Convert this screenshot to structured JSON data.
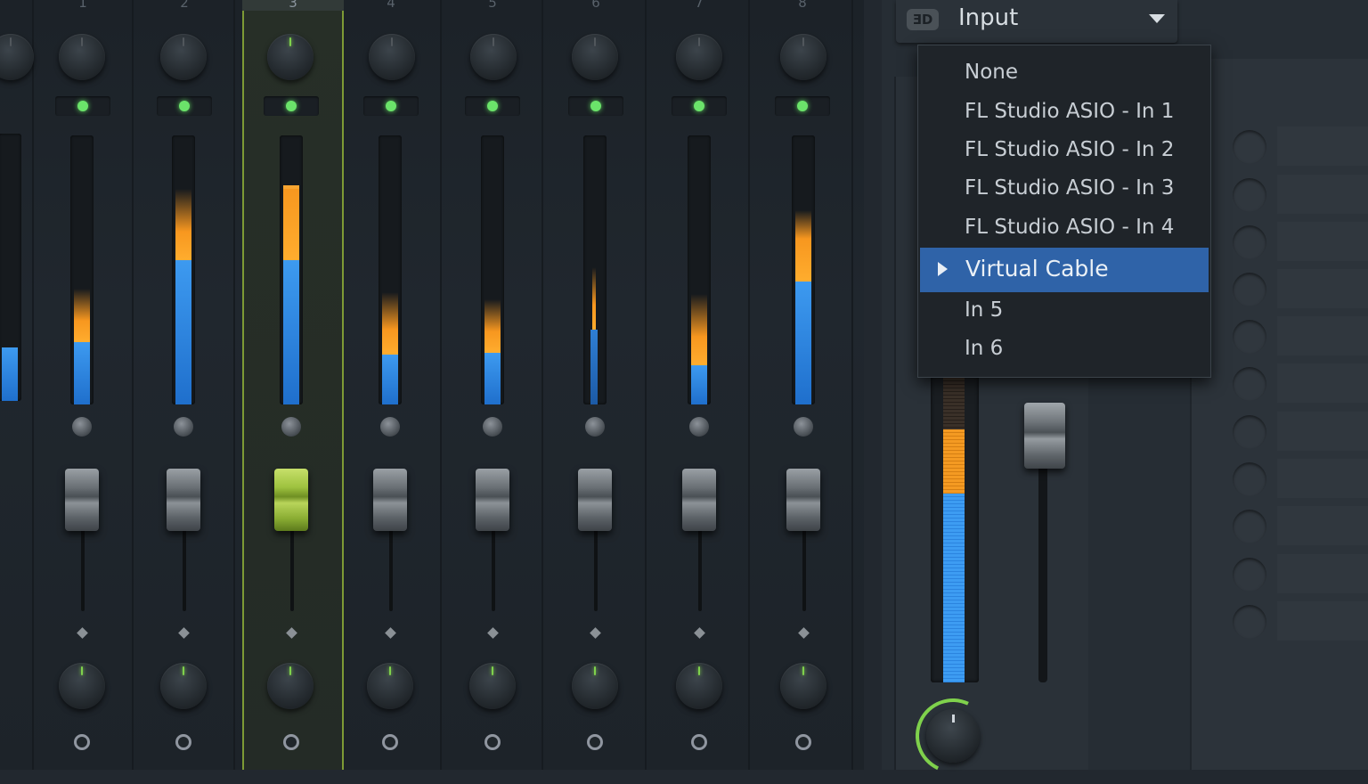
{
  "mixer": {
    "channels": [
      {
        "number": "1",
        "selected": false
      },
      {
        "number": "2",
        "selected": false
      },
      {
        "number": "3",
        "selected": true
      },
      {
        "number": "4",
        "selected": false
      },
      {
        "number": "5",
        "selected": false
      },
      {
        "number": "6",
        "selected": false
      },
      {
        "number": "7",
        "selected": false
      },
      {
        "number": "8",
        "selected": false
      }
    ]
  },
  "input_panel": {
    "label": "Input",
    "icon": "audio-input-icon"
  },
  "dropdown": {
    "items": [
      {
        "label": "None",
        "selected": false
      },
      {
        "label": "FL Studio ASIO - In 1",
        "selected": false
      },
      {
        "label": "FL Studio ASIO - In 2",
        "selected": false
      },
      {
        "label": "FL Studio ASIO - In 3",
        "selected": false
      },
      {
        "label": "FL Studio ASIO - In 4",
        "selected": false
      },
      {
        "label": "Virtual Cable",
        "selected": true
      },
      {
        "label": "In 5",
        "selected": false
      },
      {
        "label": "In 6",
        "selected": false
      }
    ]
  },
  "colors": {
    "accent_green": "#7fd14c",
    "selection_blue": "#2f63a8",
    "meter_blue": "#3d9af0",
    "meter_orange": "#f7971f"
  }
}
